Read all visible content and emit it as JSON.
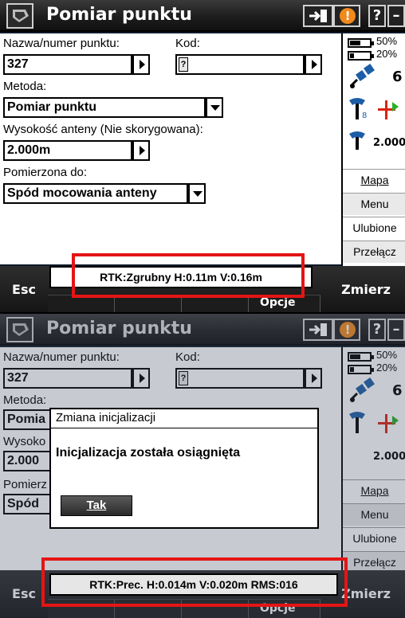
{
  "screen1": {
    "title": "Pomiar punktu",
    "labels": {
      "point_name": "Nazwa/numer punktu:",
      "code": "Kod:",
      "method": "Metoda:",
      "antenna_height": "Wysokość anteny (Nie skorygowana):",
      "measured_to": "Pomierzona do:"
    },
    "values": {
      "point_name": "327",
      "code": "",
      "method": "Pomiar punktu",
      "antenna_height": "2.000m",
      "measured_to": "Spód mocowania anteny"
    },
    "status": {
      "battery1": "50%",
      "battery2": "20%",
      "satellites": "6",
      "antenna": "2.000"
    },
    "side_buttons": [
      "Mapa",
      "Menu",
      "Ulubione",
      "Przełącz"
    ],
    "bottom": {
      "esc": "Esc",
      "measure": "Zmierz",
      "options": "Opcje",
      "rtk_status": "RTK:Zgrubny H:0.11m V:0.16m"
    }
  },
  "screen2": {
    "title": "Pomiar punktu",
    "labels": {
      "point_name": "Nazwa/numer punktu:",
      "code": "Kod:",
      "method": "Metoda:",
      "antenna_height": "Wysoko",
      "measured_to": "Pomierz"
    },
    "values": {
      "point_name": "327",
      "method": "Pomia",
      "antenna_height": "2.000",
      "measured_to": "Spód"
    },
    "status": {
      "battery1": "50%",
      "battery2": "20%",
      "satellites": "6",
      "antenna": "2.000"
    },
    "side_buttons": [
      "Mapa",
      "Menu",
      "Ulubione",
      "Przełącz"
    ],
    "dialog": {
      "title": "Zmiana inicjalizacji",
      "message": "Inicjalizacja została osiągnięta",
      "ok_label": "Tak"
    },
    "bottom": {
      "esc": "Esc",
      "measure": "Zmierz",
      "options": "Opcje",
      "rtk_status": "RTK:Prec. H:0.014m V:0.020m RMS:016"
    }
  },
  "colors": {
    "highlight": "#e41515",
    "warning": "#f08a1c",
    "titlebar": "#1e1e1e"
  }
}
